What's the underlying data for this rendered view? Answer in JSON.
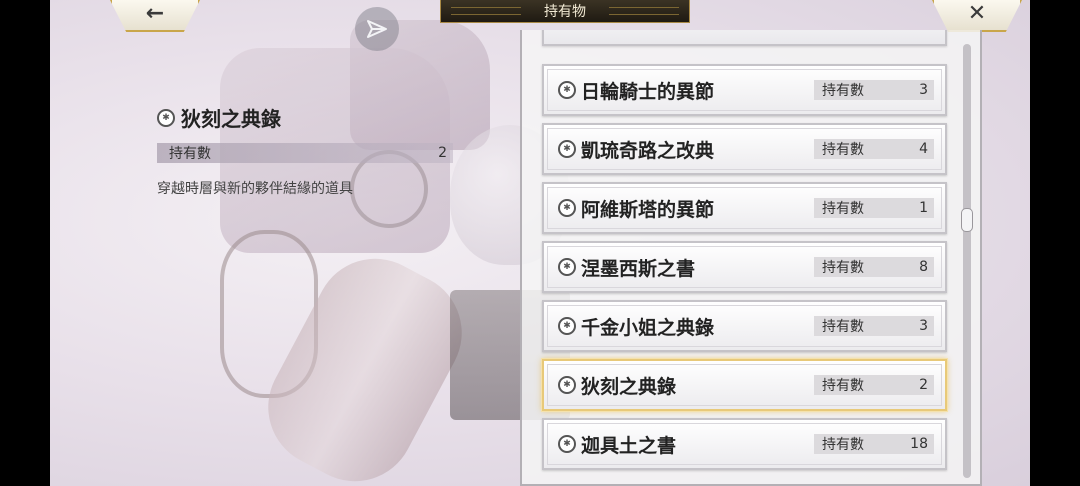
{
  "header": {
    "title": "持有物",
    "back_icon": "←",
    "close_icon": "✕"
  },
  "detail": {
    "name": "狄刻之典錄",
    "count_label": "持有數",
    "count_value": "2",
    "description": "穿越時層與新的夥伴結緣的道具"
  },
  "items": [
    {
      "name": "日輪騎士的異節",
      "count_label": "持有數",
      "count": "3",
      "selected": false
    },
    {
      "name": "凱琉奇路之改典",
      "count_label": "持有數",
      "count": "4",
      "selected": false
    },
    {
      "name": "阿維斯塔的異節",
      "count_label": "持有數",
      "count": "1",
      "selected": false
    },
    {
      "name": "涅墨西斯之書",
      "count_label": "持有數",
      "count": "8",
      "selected": false
    },
    {
      "name": "千金小姐之典錄",
      "count_label": "持有數",
      "count": "3",
      "selected": false
    },
    {
      "name": "狄刻之典錄",
      "count_label": "持有數",
      "count": "2",
      "selected": true
    },
    {
      "name": "迦具土之書",
      "count_label": "持有數",
      "count": "18",
      "selected": false
    }
  ],
  "icons": {
    "item": "book-icon",
    "share": "send-icon"
  },
  "scroll": {
    "position_fraction": 0.4
  }
}
